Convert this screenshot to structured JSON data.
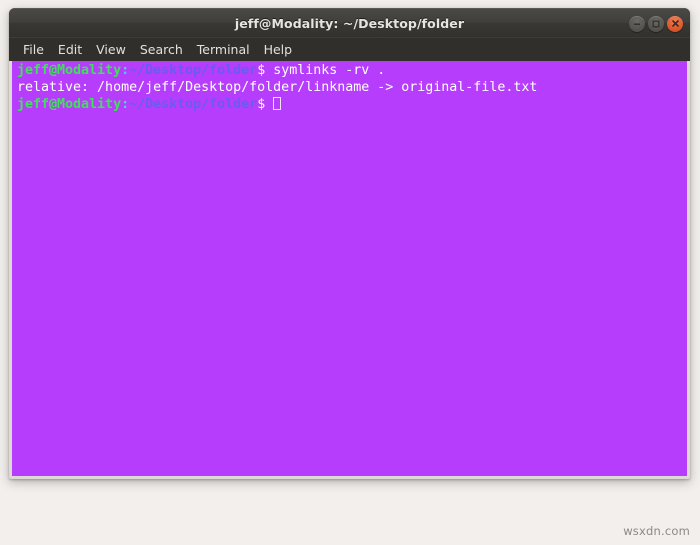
{
  "window": {
    "title": "jeff@Modality: ~/Desktop/folder",
    "controls": [
      {
        "name": "minimize-button",
        "glyph": "–",
        "style": "grey"
      },
      {
        "name": "maximize-button",
        "glyph": "□",
        "style": "grey"
      },
      {
        "name": "close-button",
        "glyph": "✕",
        "style": "close"
      }
    ],
    "colors": {
      "titlebar": "#3c3b37",
      "menubar": "#302f2c",
      "terminal_background": "#b63dfb",
      "terminal_border": "#ded9d4",
      "page_background": "#f2efec",
      "close_button": "#df5b30"
    }
  },
  "menu": {
    "items": [
      {
        "label": "File"
      },
      {
        "label": "Edit"
      },
      {
        "label": "View"
      },
      {
        "label": "Search"
      },
      {
        "label": "Terminal"
      },
      {
        "label": "Help"
      }
    ]
  },
  "terminal": {
    "prompt": {
      "user_host": "jeff@Modality",
      "colon": ":",
      "path": "~/Desktop/folder",
      "dollar": "$ "
    },
    "colors": {
      "user_host": "#3fe05a",
      "colon": "#42d7e8",
      "path": "#6a5cf0",
      "text": "#ffffff"
    },
    "lines": [
      {
        "type": "prompt",
        "command": "symlinks -rv ."
      },
      {
        "type": "output",
        "text": "relative: /home/jeff/Desktop/folder/linkname -> original-file.txt"
      },
      {
        "type": "prompt",
        "command": "",
        "cursor": true
      }
    ]
  },
  "watermark": {
    "text": "wsxdn.com"
  }
}
